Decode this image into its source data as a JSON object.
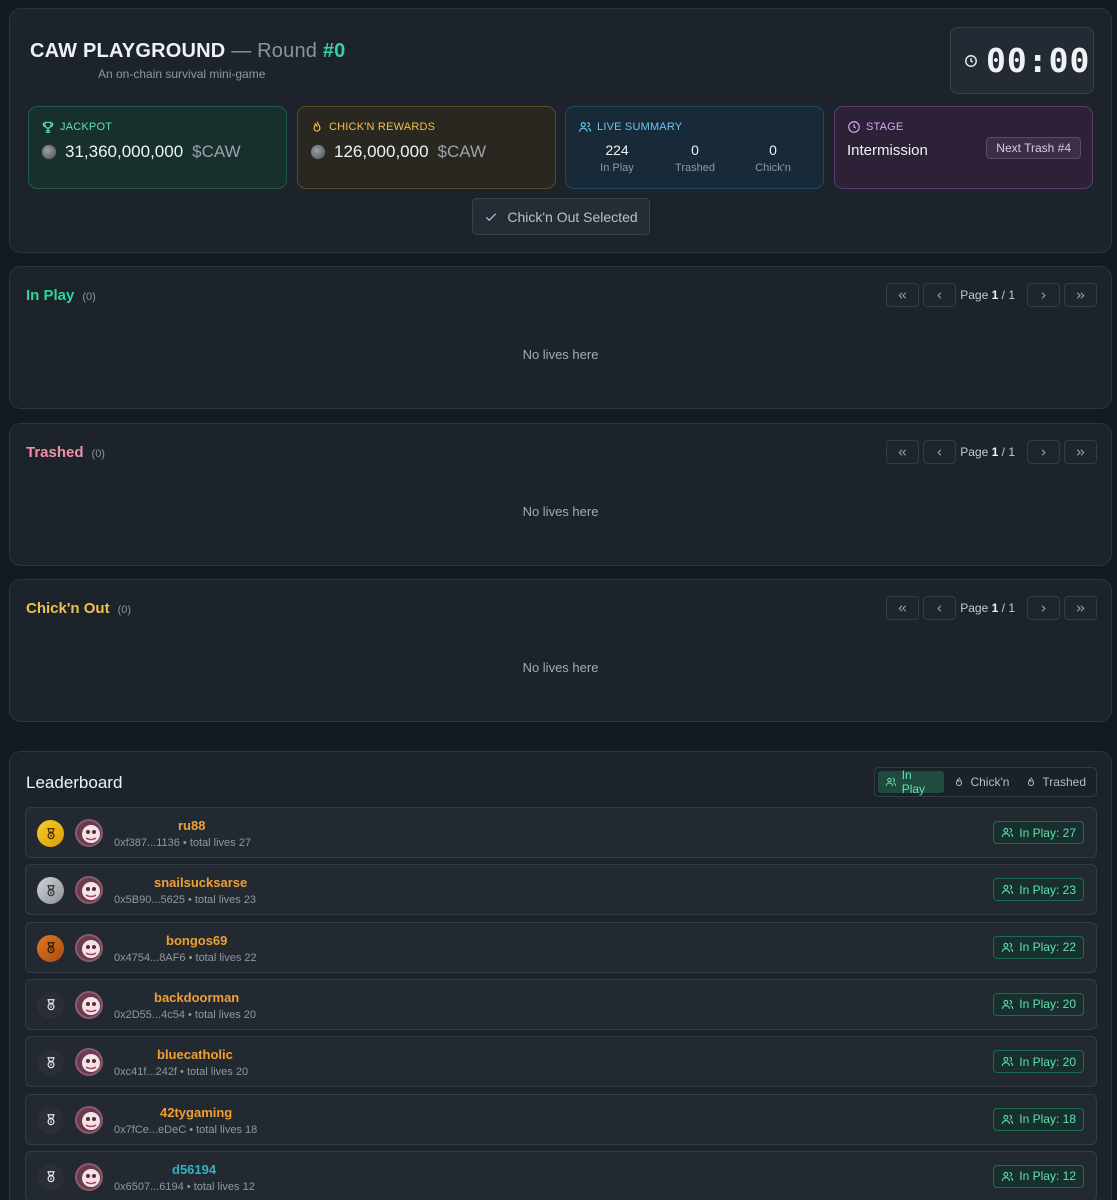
{
  "header": {
    "brand": "CAW PLAYGROUND",
    "dash": "—",
    "round_label": "Round",
    "round_number": "#0",
    "subtitle": "An on-chain survival mini-game",
    "timer": "00:00"
  },
  "stats": {
    "jackpot": {
      "label": "JACKPOT",
      "amount": "31,360,000,000",
      "currency": "$CAW",
      "icon": "trophy-icon"
    },
    "chickn_rewards": {
      "label": "CHICK'N REWARDS",
      "amount": "126,000,000",
      "currency": "$CAW",
      "icon": "flame-icon"
    },
    "live_summary": {
      "label": "LIVE SUMMARY",
      "icon": "users-icon",
      "items": [
        {
          "value": "224",
          "label": "In Play"
        },
        {
          "value": "0",
          "label": "Trashed"
        },
        {
          "value": "0",
          "label": "Chick'n"
        }
      ]
    },
    "stage": {
      "label": "STAGE",
      "value": "Intermission",
      "next": "Next Trash #4",
      "icon": "clock-icon"
    }
  },
  "chickout_button": "Chick'n Out Selected",
  "sections": [
    {
      "id": "inplay",
      "title": "In Play",
      "count": "(0)",
      "page_word": "Page",
      "page_current": "1",
      "page_sep": "/",
      "page_total": "1",
      "empty": "No lives here"
    },
    {
      "id": "trashed",
      "title": "Trashed",
      "count": "(0)",
      "page_word": "Page",
      "page_current": "1",
      "page_sep": "/",
      "page_total": "1",
      "empty": "No lives here"
    },
    {
      "id": "chickout",
      "title": "Chick'n Out",
      "count": "(0)",
      "page_word": "Page",
      "page_current": "1",
      "page_sep": "/",
      "page_total": "1",
      "empty": "No lives here"
    }
  ],
  "leaderboard": {
    "title": "Leaderboard",
    "tabs": [
      {
        "label": "In Play",
        "icon": "users-icon",
        "active": true
      },
      {
        "label": "Chick'n",
        "icon": "flame-icon",
        "active": false
      },
      {
        "label": "Trashed",
        "icon": "flame-icon",
        "active": false
      }
    ],
    "rows": [
      {
        "rank": "gold",
        "name": "ru88",
        "meta": "0xf387...1136 • total lives 27",
        "badge": "In Play: 27"
      },
      {
        "rank": "silver",
        "name": "snailsucksarse",
        "meta": "0x5B90...5625 • total lives 23",
        "badge": "In Play: 23"
      },
      {
        "rank": "bronze",
        "name": "bongos69",
        "meta": "0x4754...8AF6 • total lives 22",
        "badge": "In Play: 22"
      },
      {
        "rank": "none",
        "name": "backdoorman",
        "meta": "0x2D55...4c54 • total lives 20",
        "badge": "In Play: 20"
      },
      {
        "rank": "none",
        "name": "bluecatholic",
        "meta": "0xc41f...242f • total lives 20",
        "badge": "In Play: 20"
      },
      {
        "rank": "none",
        "name": "42tygaming",
        "meta": "0x7fCe...eDeC • total lives 18",
        "badge": "In Play: 18"
      },
      {
        "rank": "none",
        "name": "d56194",
        "meta": "0x6507...6194 • total lives 12",
        "badge": "In Play: 12"
      }
    ]
  },
  "colors": {
    "background": "#141a21",
    "accent_green": "#35d39a",
    "gold": "#f0b90b",
    "silver": "#a0a4a8",
    "bronze": "#c8681c",
    "username": "#f0a030"
  }
}
